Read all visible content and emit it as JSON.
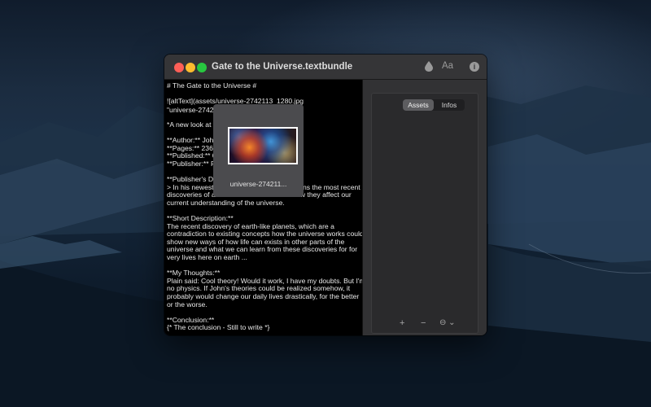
{
  "window": {
    "title": "Gate to the Universe.textbundle"
  },
  "toolbar": {
    "font_label": "Aa",
    "info_label": "i"
  },
  "editor": {
    "lines": [
      "# The Gate to the Universe #",
      "",
      "![altText](assets/universe-2742113_1280.jpg",
      "\"universe-2742113_1280.jpg\")",
      "",
      "*A new look at the secrets of our universe*",
      "",
      "**Author:** John Appleseed",
      "**Pages:** 236",
      "**Published:** 01.01.2015",
      "**Publisher:** Pine-Three Publishing",
      "",
      "**Publisher's Description**",
      "> In his newest book John Appleseed explains the most recent",
      "discoveries of astronomical science and how they affect our",
      "current understanding of the universe.",
      "",
      "**Short Description:**",
      "The recent discovery of earth-like planets, which are a",
      "contradiction to existing concepts how the universe works could",
      "show new ways of how life can exists in other parts of the",
      "universe and what we can learn from these discoveries for for",
      "very lives here on earth ...",
      "",
      "**My Thoughts:**",
      "Plain said: Cool theory! Would it work, I have my doubts. But I'm",
      "no physics. If John's theories could be realized somehow, it",
      "probably would change our daily lives drastically, for the better",
      "or the worse.",
      "",
      "**Conclusion:**",
      "{* The conclusion - Still to write *}"
    ]
  },
  "sidebar": {
    "tabs": [
      {
        "label": "Assets",
        "active": true
      },
      {
        "label": "Infos",
        "active": false
      }
    ],
    "asset": {
      "name": "universe-274211..."
    },
    "buttons": {
      "add": "+",
      "remove": "−",
      "more": "⊖ ⌄"
    }
  },
  "colors": {
    "close": "#fe5f57",
    "minimize": "#febc2e",
    "maximize": "#28c840"
  }
}
